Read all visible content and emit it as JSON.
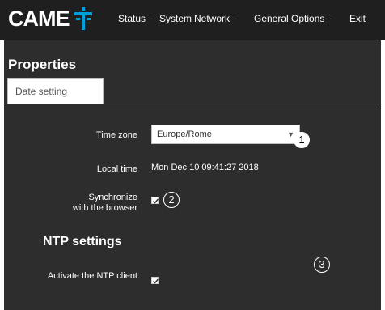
{
  "brand": {
    "name": "CAME",
    "logo_icon": "came-t-logo-icon",
    "accent_color": "#00a0dc"
  },
  "nav": {
    "items": [
      {
        "label": "Status",
        "caret": "−"
      },
      {
        "label": "System",
        "caret": "−"
      },
      {
        "label": "Network",
        "caret": "−"
      },
      {
        "label": "General Options",
        "caret": "−"
      },
      {
        "label": "Exit",
        "caret": ""
      }
    ]
  },
  "page": {
    "title": "Properties"
  },
  "tabs": [
    {
      "label": "Date setting",
      "active": true
    }
  ],
  "form": {
    "time_zone": {
      "label": "Time zone",
      "value": "Europe/Rome",
      "caret": "▼"
    },
    "local_time": {
      "label": "Local time",
      "value": "Mon Dec 10 09:41:27 2018"
    },
    "sync_browser": {
      "label_line1": "Synchronize",
      "label_line2": "with the browser",
      "checked": true
    },
    "ntp": {
      "section_title": "NTP settings",
      "activate": {
        "label": "Activate the NTP client",
        "checked": true
      }
    }
  },
  "callouts": {
    "one": "1",
    "two": "2",
    "three": "3"
  }
}
